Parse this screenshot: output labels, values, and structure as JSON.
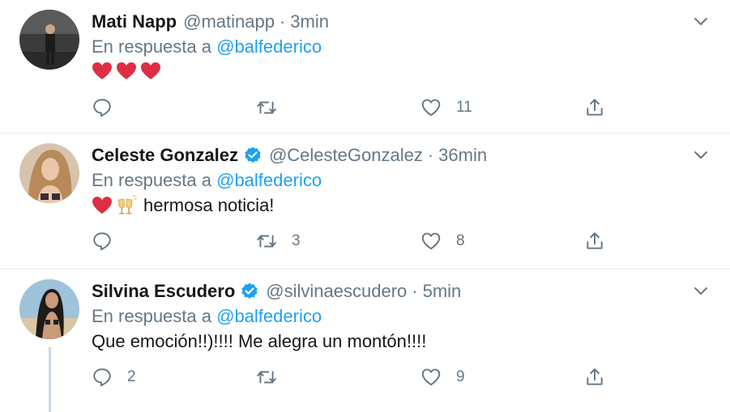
{
  "tweets": [
    {
      "name": "Mati Napp",
      "handle": "@matinapp",
      "dot": "·",
      "time": "3min",
      "verified": false,
      "reply_prefix": "En respuesta a",
      "reply_to": "@balfederico",
      "text": "",
      "emojis": [
        "red-heart",
        "red-heart",
        "red-heart"
      ],
      "replies": "",
      "retweets": "",
      "likes": "11"
    },
    {
      "name": "Celeste Gonzalez",
      "handle": "@CelesteGonzalez",
      "dot": "·",
      "time": "36min",
      "verified": true,
      "reply_prefix": "En respuesta a",
      "reply_to": "@balfederico",
      "text": "hermosa noticia!",
      "emojis": [
        "red-heart",
        "clinking-glasses"
      ],
      "replies": "",
      "retweets": "3",
      "likes": "8"
    },
    {
      "name": "Silvina Escudero",
      "handle": "@silvinaescudero",
      "dot": "·",
      "time": "5min",
      "verified": true,
      "reply_prefix": "En respuesta a",
      "reply_to": "@balfederico",
      "text": "Que emoción!!)!!!! Me alegra un montón!!!!",
      "emojis": [],
      "replies": "2",
      "retweets": "",
      "likes": "9"
    }
  ],
  "colors": {
    "link": "#1da1f2",
    "muted": "#657786",
    "verified": "#1da1f2",
    "heart": "#e0245e",
    "border": "#e6ecf0"
  },
  "icons": [
    "comment-icon",
    "retweet-icon",
    "like-icon",
    "share-icon",
    "chevron-down-icon",
    "verified-badge-icon"
  ]
}
